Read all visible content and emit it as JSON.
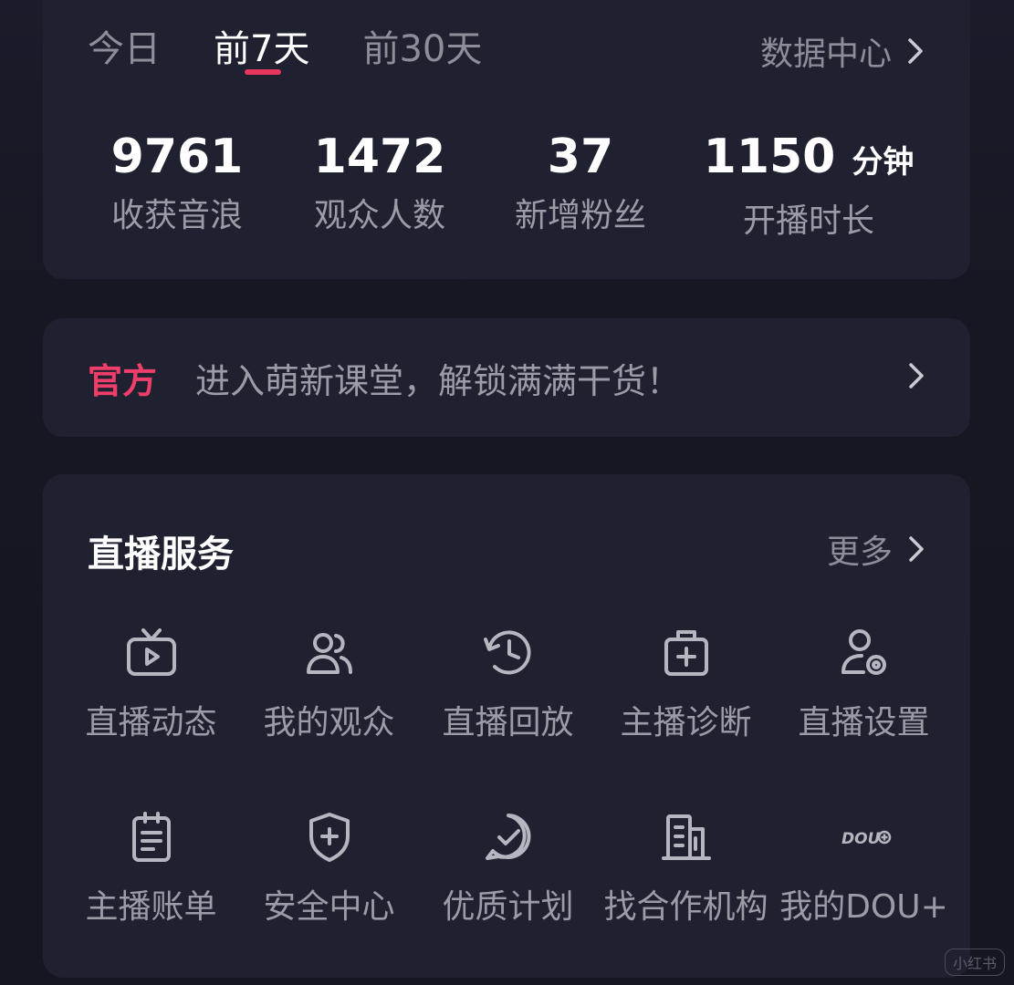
{
  "stats_card": {
    "tabs": [
      "今日",
      "前7天",
      "前30天"
    ],
    "active_tab_index": 1,
    "data_center_label": "数据中心",
    "stats": [
      {
        "value": "9761",
        "unit": "",
        "label": "收获音浪"
      },
      {
        "value": "1472",
        "unit": "",
        "label": "观众人数"
      },
      {
        "value": "37",
        "unit": "",
        "label": "新增粉丝"
      },
      {
        "value": "1150",
        "unit": "分钟",
        "label": "开播时长"
      }
    ]
  },
  "banner": {
    "tag": "官方",
    "text": "进入萌新课堂，解锁满满干货！"
  },
  "services": {
    "title": "直播服务",
    "more_label": "更多",
    "items": [
      {
        "label": "直播动态",
        "icon": "live-tv-icon"
      },
      {
        "label": "我的观众",
        "icon": "audience-icon"
      },
      {
        "label": "直播回放",
        "icon": "replay-clock-icon"
      },
      {
        "label": "主播诊断",
        "icon": "medical-kit-icon"
      },
      {
        "label": "直播设置",
        "icon": "user-settings-icon"
      },
      {
        "label": "主播账单",
        "icon": "bill-clipboard-icon"
      },
      {
        "label": "安全中心",
        "icon": "shield-plus-icon"
      },
      {
        "label": "优质计划",
        "icon": "quality-check-icon"
      },
      {
        "label": "找合作机构",
        "icon": "building-icon"
      },
      {
        "label": "我的DOU+",
        "icon": "dou-plus-icon",
        "badge": "DOU"
      }
    ]
  },
  "watermark": "小红书",
  "colors": {
    "accent": "#e8365f",
    "tag": "#ef3e69",
    "muted_text": "#9a9ca8",
    "card_bg": "#1f2130",
    "page_bg": "#161722"
  }
}
